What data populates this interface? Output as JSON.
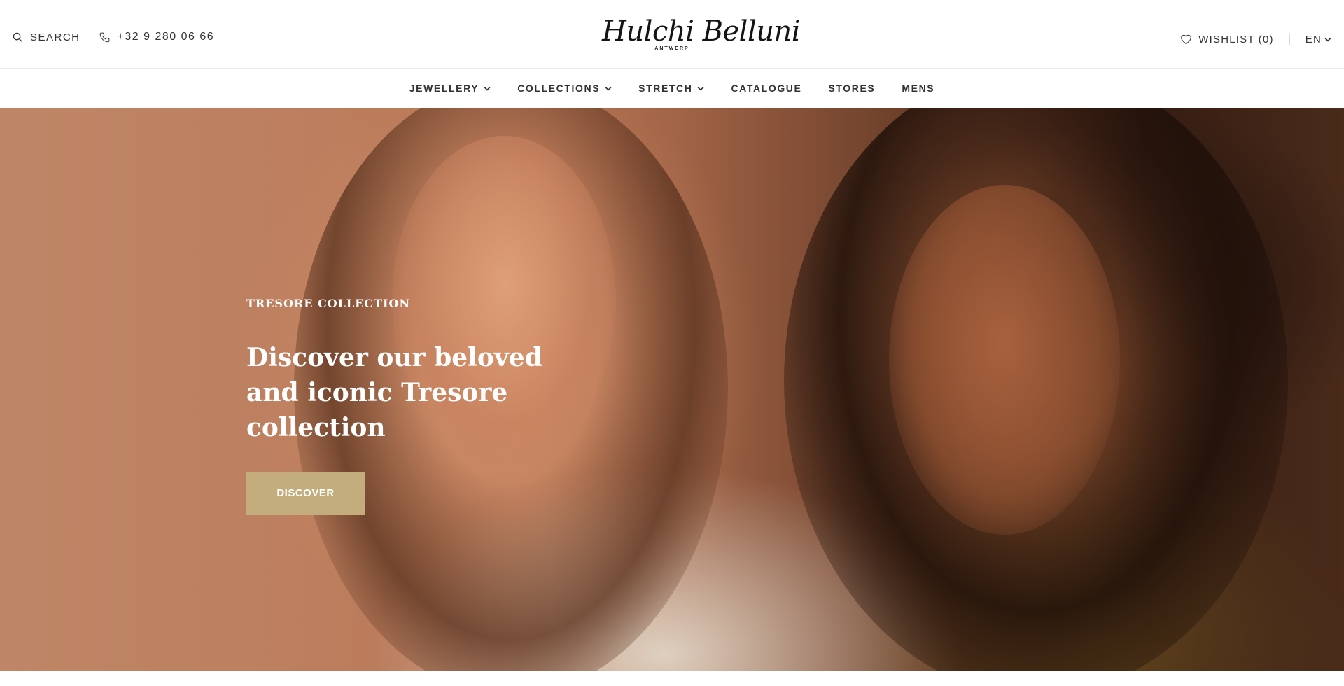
{
  "header": {
    "search_label": "SEARCH",
    "phone": "+32 9 280 06 66",
    "logo_script": "Hulchi Belluni",
    "logo_sub": "ANTWERP",
    "wishlist_label": "WISHLIST (0)",
    "language": "EN"
  },
  "nav": {
    "items": [
      {
        "label": "JEWELLERY",
        "has_dropdown": true
      },
      {
        "label": "COLLECTIONS",
        "has_dropdown": true
      },
      {
        "label": "STRETCH",
        "has_dropdown": true
      },
      {
        "label": "CATALOGUE",
        "has_dropdown": false
      },
      {
        "label": "STORES",
        "has_dropdown": false
      },
      {
        "label": "MENS",
        "has_dropdown": false
      }
    ]
  },
  "hero": {
    "eyebrow": "TRESORE COLLECTION",
    "headline": "Discover our beloved and iconic Tresore collection",
    "cta_label": "DISCOVER"
  },
  "colors": {
    "accent": "#c3ad7c",
    "text": "#333333"
  }
}
